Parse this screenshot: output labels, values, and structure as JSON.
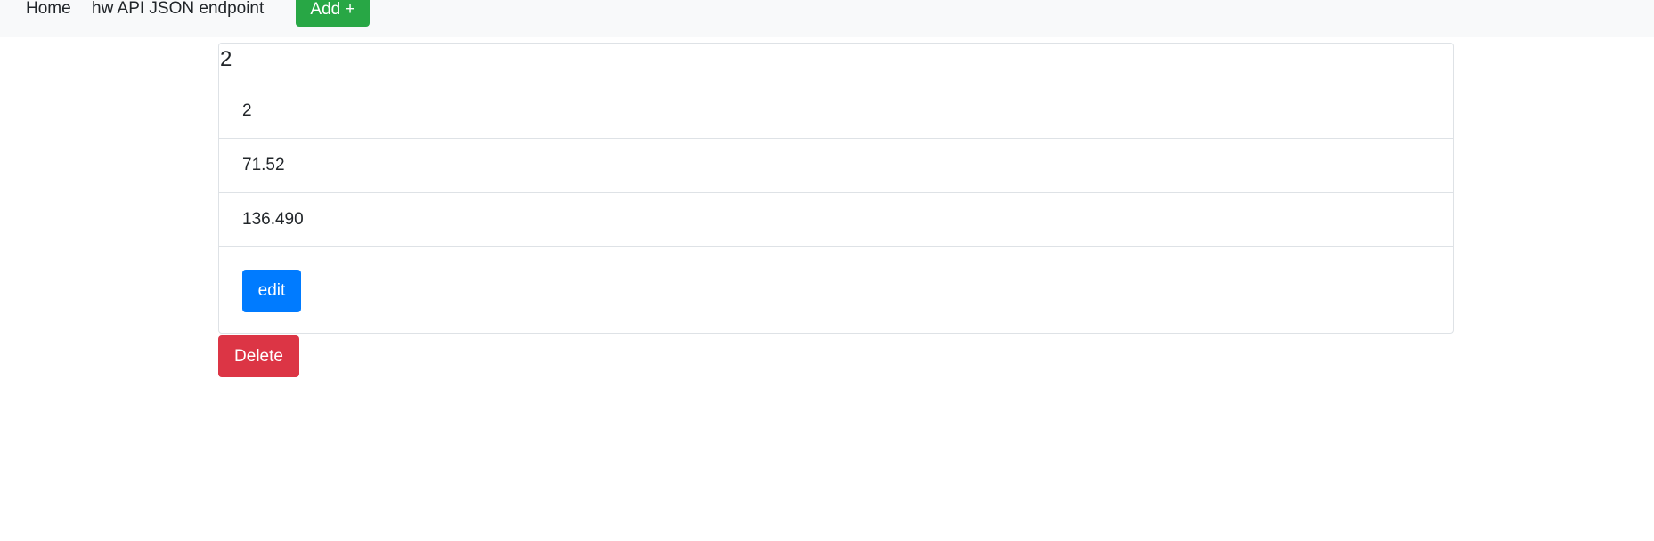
{
  "nav": {
    "home": "Home",
    "api": "hw API JSON endpoint",
    "add": "Add +"
  },
  "record": {
    "title": "2",
    "fields": [
      "2",
      "71.52",
      "136.490"
    ],
    "edit_label": "edit",
    "delete_label": "Delete"
  },
  "colors": {
    "add": "#28a745",
    "edit": "#007bff",
    "delete": "#dc3545",
    "navbar": "#f8f9fa"
  }
}
